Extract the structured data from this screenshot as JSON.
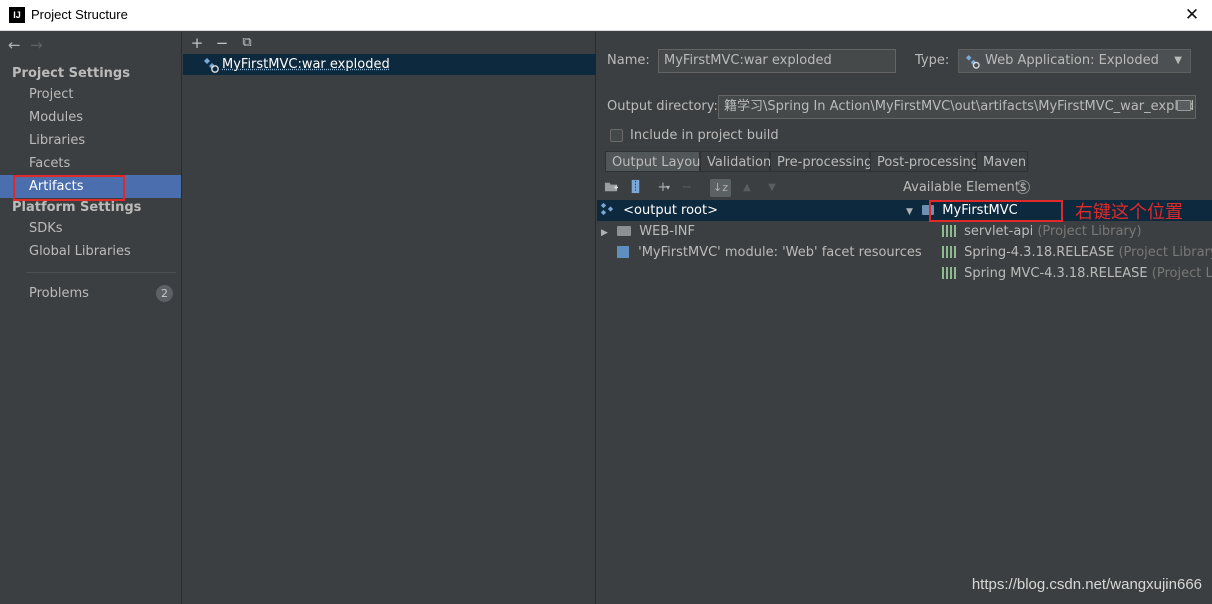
{
  "window": {
    "title": "Project Structure",
    "logo_text": "IJ",
    "close_glyph": "✕"
  },
  "nav": {
    "back": "←",
    "forward": "→"
  },
  "sidebar": {
    "project_settings_header": "Project Settings",
    "project_items": [
      "Project",
      "Modules",
      "Libraries",
      "Facets",
      "Artifacts"
    ],
    "selected": "Artifacts",
    "platform_settings_header": "Platform Settings",
    "platform_items": [
      "SDKs",
      "Global Libraries"
    ],
    "problems_label": "Problems",
    "problems_count": "2"
  },
  "middle": {
    "toolbar": {
      "add": "+",
      "remove": "−",
      "copy": "⧉"
    },
    "artifacts": [
      "MyFirstMVC:war exploded"
    ]
  },
  "details": {
    "name_label": "Name:",
    "name_value": "MyFirstMVC:war exploded",
    "type_label": "Type:",
    "type_value": "Web Application: Exploded",
    "output_dir_label": "Output directory:",
    "output_dir_value": "籍学习\\Spring In Action\\MyFirstMVC\\out\\artifacts\\MyFirstMVC_war_exploded",
    "include_build_label": "Include in project build",
    "include_build_checked": false
  },
  "tabs": [
    "Output Layout",
    "Validation",
    "Pre-processing",
    "Post-processing",
    "Maven"
  ],
  "active_tab": "Output Layout",
  "layout_toolbar": {
    "plus": "+",
    "minus": "−",
    "sort": "↓z",
    "up": "▲",
    "down": "▼"
  },
  "output_tree": [
    {
      "label": "<output root>",
      "expander": "",
      "selected": true
    },
    {
      "label": "WEB-INF",
      "expander": "▶",
      "selected": false
    },
    {
      "label": "'MyFirstMVC' module: 'Web' facet resources",
      "expander": "",
      "selected": false
    }
  ],
  "available_elements": {
    "label": "Available Elements",
    "help": "?",
    "module": {
      "label": "MyFirstMVC",
      "expander": "▼"
    },
    "libraries": [
      {
        "name": "servlet-api",
        "suffix": "(Project Library)"
      },
      {
        "name": "Spring-4.3.18.RELEASE",
        "suffix": "(Project Library)"
      },
      {
        "name": "Spring MVC-4.3.18.RELEASE",
        "suffix": "(Project Library)"
      }
    ]
  },
  "annotation": "右键这个位置",
  "watermark": "https://blog.csdn.net/wangxujin666",
  "colors": {
    "selection": "#4b6eaf",
    "tree_selection": "#0d293e",
    "annotation": "#e02a2a",
    "background": "#3c3f41"
  }
}
